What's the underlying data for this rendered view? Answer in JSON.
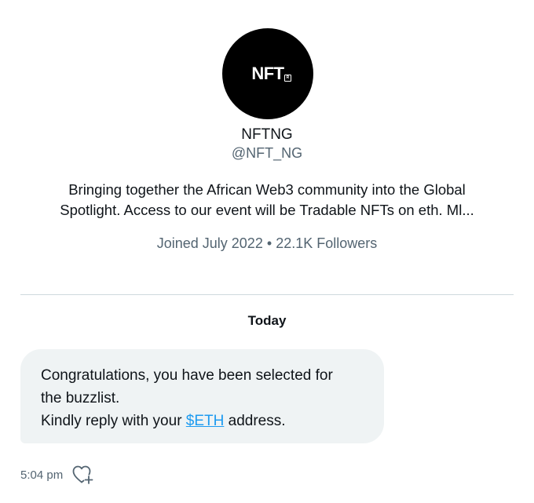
{
  "profile": {
    "avatar_text": "NFT",
    "display_name": "NFTNG",
    "handle": "@NFT_NG",
    "bio_line1": "Bringing together the African Web3 community into the Global",
    "bio_line2": "Spotlight. Access to our event will be Tradable NFTs on eth. Ml...",
    "joined": "Joined July 2022",
    "separator": "•",
    "followers": "22.1K Followers"
  },
  "conversation": {
    "day_label": "Today",
    "message": {
      "line1": "Congratulations, you have been selected for",
      "line2": "the buzzlist.",
      "line3_prefix": "Kindly reply with your ",
      "line3_link": "$ETH",
      "line3_suffix": " address.",
      "time": "5:04 pm",
      "like_icon": "heart-plus-icon"
    }
  },
  "colors": {
    "text_primary": "#0f1419",
    "text_secondary": "#536471",
    "link": "#1d9bf0",
    "bubble_bg": "#eff3f4",
    "divider": "#cfd9de",
    "avatar_bg": "#000000"
  }
}
